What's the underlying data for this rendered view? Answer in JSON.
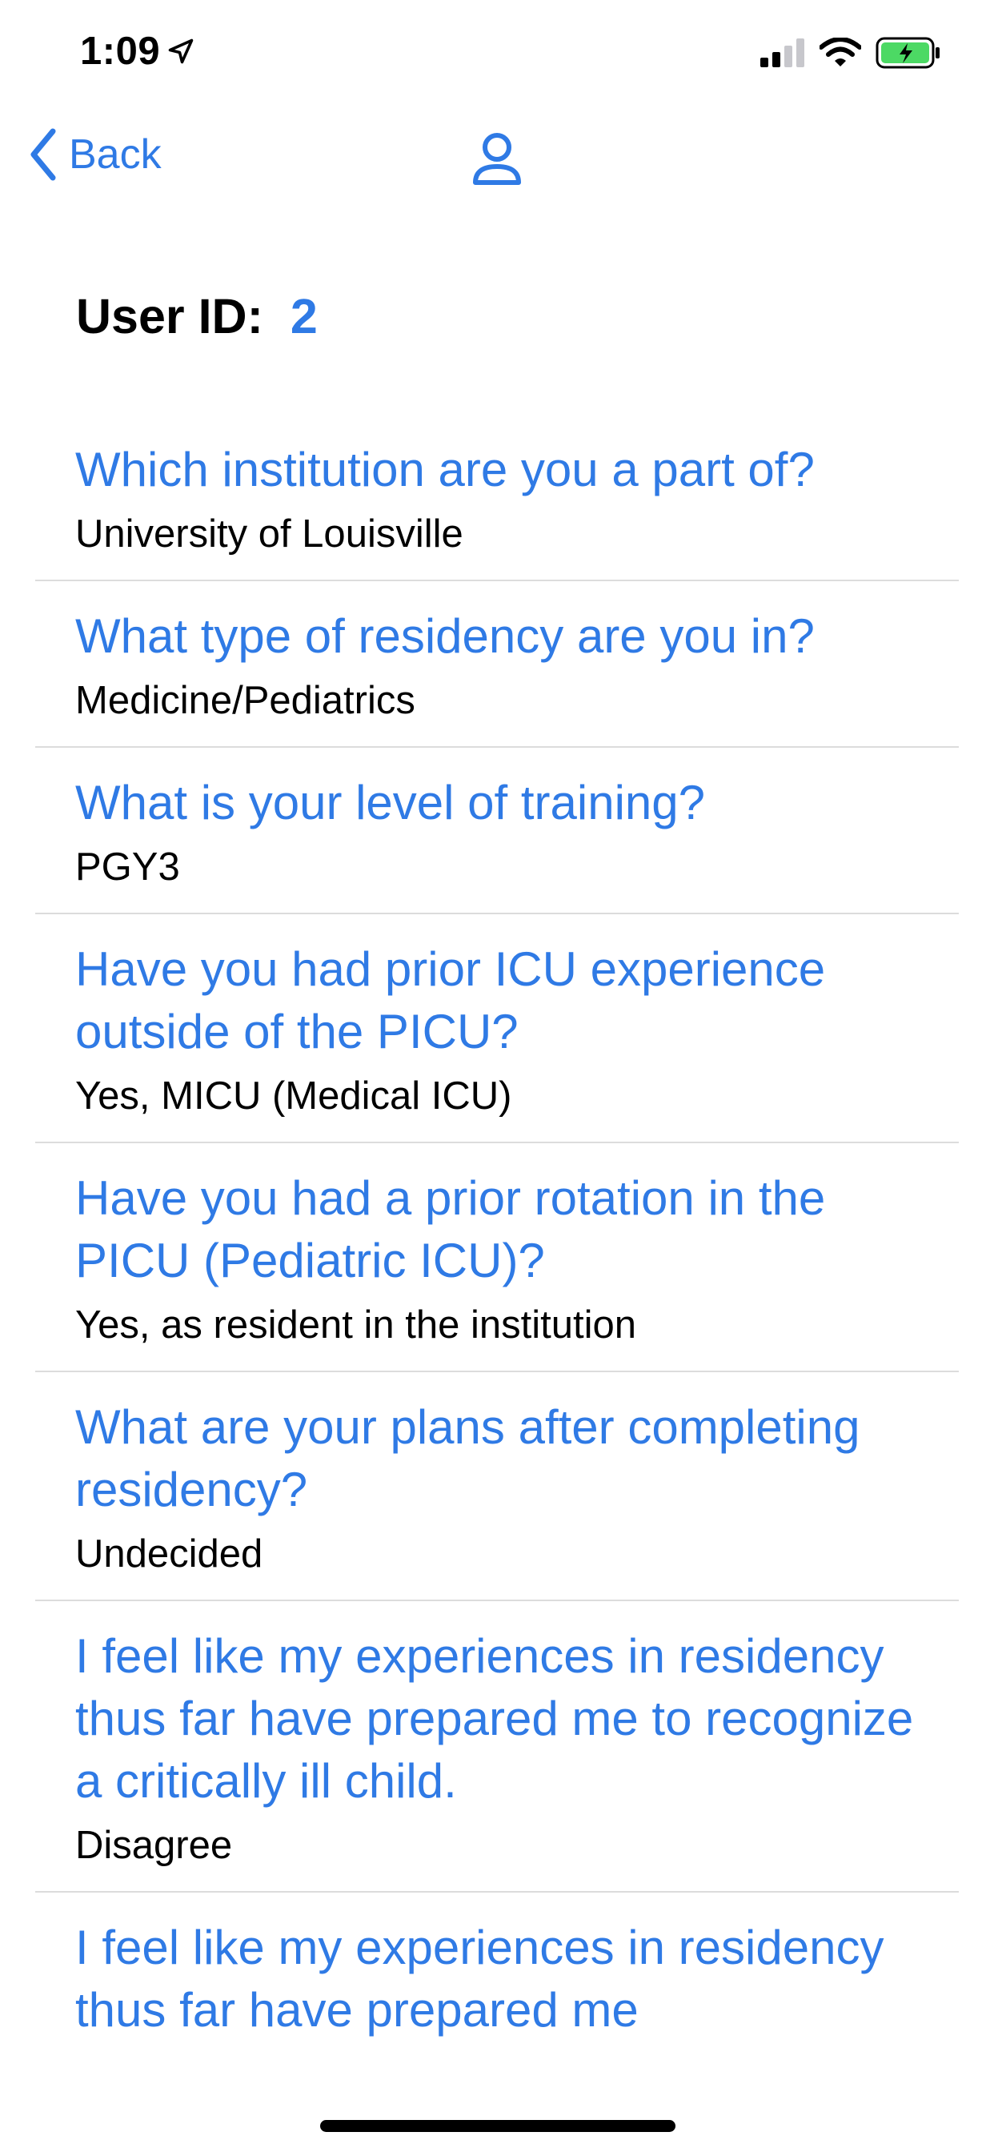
{
  "status_bar": {
    "time": "1:09",
    "icons": [
      "location-arrow-icon",
      "signal-bars-icon",
      "wifi-icon",
      "battery-charging-icon"
    ],
    "battery_color": "#4cd964"
  },
  "nav": {
    "back_label": "Back",
    "icons": [
      "chevron-left-icon",
      "person-icon"
    ]
  },
  "user": {
    "id_label": "User ID:",
    "id_value": "2"
  },
  "questions": [
    {
      "question": "Which institution are you a part of?",
      "answer": "University of Louisville"
    },
    {
      "question": "What type of residency are you in?",
      "answer": "Medicine/Pediatrics"
    },
    {
      "question": "What is your level of training?",
      "answer": "PGY3"
    },
    {
      "question": "Have you had prior ICU experience outside of the PICU?",
      "answer": "Yes, MICU (Medical ICU)"
    },
    {
      "question": "Have you had a prior rotation in the PICU (Pediatric ICU)?",
      "answer": "Yes, as resident in the institution"
    },
    {
      "question": "What are your plans after completing residency?",
      "answer": "Undecided"
    },
    {
      "question": "I feel like my experiences in residency thus far have prepared me to recognize a critically ill child.",
      "answer": "Disagree"
    },
    {
      "question": "I feel like my experiences in residency thus far have prepared me",
      "answer": ""
    }
  ],
  "colors": {
    "accent": "#2f7ae5",
    "divider": "#dcdcdc"
  }
}
